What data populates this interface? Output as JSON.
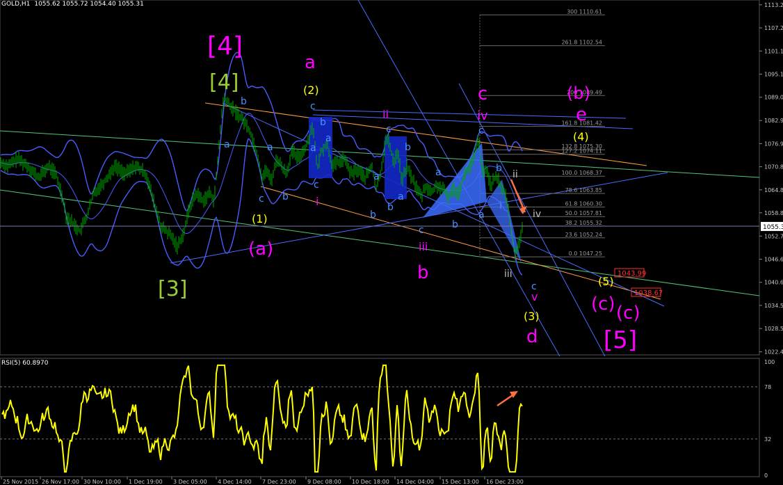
{
  "header": {
    "symbol": "GOLD,H1",
    "ohlc": "1055.62 1055.72 1054.40 1055.31"
  },
  "rsi": {
    "label": "RSI(5) 60.8970",
    "levels": [
      "100",
      "78",
      "32",
      "0"
    ]
  },
  "chart_data": [
    {
      "type": "candlestick",
      "name": "GOLD,H1",
      "y_ticks": [
        1113.25,
        1107.2,
        1101.15,
        1095.1,
        1089.05,
        1082.95,
        1076.9,
        1070.85,
        1064.8,
        1058.8,
        1052.7,
        1046.65,
        1040.6,
        1034.55,
        1028.5,
        1022.4
      ],
      "y_tick_labels": [
        "1113.25",
        "1107.20",
        "1101.15",
        "1095.10",
        "1089.05",
        "1082.95",
        "1076.90",
        "1070.85",
        "1064.80",
        "1058.80",
        "1052.70",
        "1046.65",
        "1040.60",
        "1034.55",
        "1028.50",
        "1022.40"
      ],
      "ylim": [
        1021.6,
        1114.5
      ],
      "current_price": 1055.31,
      "current_price_label": "1055.31",
      "x_tick_labels": [
        "25 Nov 2015",
        "26 Nov 17:00",
        "30 Nov 10:00",
        "1 Dec 19:00",
        "3 Dec 05:00",
        "4 Dec 14:00",
        "7 Dec 23:00",
        "9 Dec 08:00",
        "10 Dec 18:00",
        "14 Dec 04:00",
        "15 Dec 13:00",
        "16 Dec 23:00"
      ],
      "price_path": [
        [
          0,
          1072
        ],
        [
          12,
          1071
        ],
        [
          25,
          1073
        ],
        [
          40,
          1071
        ],
        [
          55,
          1068
        ],
        [
          70,
          1071
        ],
        [
          80,
          1069
        ],
        [
          90,
          1063
        ],
        [
          95,
          1058
        ],
        [
          105,
          1056
        ],
        [
          115,
          1054
        ],
        [
          125,
          1058
        ],
        [
          135,
          1064
        ],
        [
          150,
          1067
        ],
        [
          165,
          1071
        ],
        [
          180,
          1069
        ],
        [
          195,
          1071
        ],
        [
          210,
          1069
        ],
        [
          222,
          1061
        ],
        [
          232,
          1055
        ],
        [
          245,
          1053
        ],
        [
          255,
          1050
        ],
        [
          265,
          1054
        ],
        [
          272,
          1060
        ],
        [
          282,
          1064
        ],
        [
          292,
          1062
        ],
        [
          302,
          1064
        ],
        [
          308,
          1062
        ],
        [
          312,
          1070
        ],
        [
          318,
          1083
        ],
        [
          322,
          1089
        ],
        [
          330,
          1087
        ],
        [
          340,
          1085
        ],
        [
          350,
          1083
        ],
        [
          360,
          1080
        ],
        [
          370,
          1074
        ],
        [
          377,
          1068
        ],
        [
          383,
          1070
        ],
        [
          390,
          1067
        ],
        [
          398,
          1073
        ],
        [
          405,
          1071
        ],
        [
          412,
          1069
        ],
        [
          420,
          1075
        ],
        [
          428,
          1073
        ],
        [
          436,
          1075
        ],
        [
          442,
          1077
        ],
        [
          450,
          1082
        ],
        [
          456,
          1070
        ],
        [
          462,
          1075
        ],
        [
          470,
          1077
        ],
        [
          478,
          1071
        ],
        [
          486,
          1072
        ],
        [
          495,
          1073
        ],
        [
          505,
          1069
        ],
        [
          515,
          1070
        ],
        [
          525,
          1068
        ],
        [
          535,
          1071
        ],
        [
          541,
          1065
        ],
        [
          548,
          1070
        ],
        [
          555,
          1078
        ],
        [
          560,
          1077
        ],
        [
          566,
          1072
        ],
        [
          572,
          1075
        ],
        [
          578,
          1067
        ],
        [
          585,
          1071
        ],
        [
          592,
          1068
        ],
        [
          600,
          1065
        ],
        [
          606,
          1063
        ],
        [
          612,
          1066
        ],
        [
          620,
          1064
        ],
        [
          628,
          1066
        ],
        [
          636,
          1065
        ],
        [
          645,
          1063
        ],
        [
          652,
          1065
        ],
        [
          660,
          1064
        ],
        [
          666,
          1068
        ],
        [
          672,
          1070
        ],
        [
          680,
          1072
        ],
        [
          688,
          1078
        ],
        [
          694,
          1069
        ],
        [
          700,
          1070
        ],
        [
          706,
          1066
        ],
        [
          712,
          1068
        ],
        [
          718,
          1067
        ],
        [
          722,
          1065
        ],
        [
          726,
          1064
        ],
        [
          730,
          1061
        ],
        [
          734,
          1055
        ],
        [
          738,
          1050
        ],
        [
          742,
          1048
        ],
        [
          746,
          1051
        ],
        [
          752,
          1055
        ]
      ],
      "fib_levels": [
        {
          "ratio": "300",
          "price": 1110.61
        },
        {
          "ratio": "261.8",
          "price": 1102.54
        },
        {
          "ratio": "200",
          "price": 1089.49
        },
        {
          "ratio": "161.8",
          "price": 1081.42
        },
        {
          "ratio": "132.8",
          "price": 1075.3
        },
        {
          "ratio": "127.2",
          "price": 1074.11
        },
        {
          "ratio": "100.0",
          "price": 1068.37
        },
        {
          "ratio": "78.6",
          "price": 1063.85
        },
        {
          "ratio": "61.8",
          "price": 1060.3
        },
        {
          "ratio": "50.0",
          "price": 1057.81
        },
        {
          "ratio": "38.2",
          "price": 1055.32
        },
        {
          "ratio": "23.6",
          "price": 1052.24
        },
        {
          "ratio": "0.0",
          "price": 1047.25
        }
      ],
      "price_tags": [
        {
          "label": "1043.99",
          "price": 1043.99
        },
        {
          "label": "1038.67",
          "price": 1038.67
        }
      ]
    },
    {
      "type": "line",
      "name": "RSI(5)",
      "ylim": [
        0,
        100
      ],
      "levels": [
        78,
        32
      ],
      "last_value": 60.897
    }
  ],
  "wave_labels": [
    {
      "text": "[4]",
      "color": "#ff00ff"
    },
    {
      "text": "[4]",
      "color": "#9acd32"
    },
    {
      "text": "[3]",
      "color": "#9acd32"
    },
    {
      "text": "[5]",
      "color": "#ff00ff"
    },
    {
      "text": "a",
      "color": "#ff00ff"
    },
    {
      "text": "b",
      "color": "#ff00ff"
    },
    {
      "text": "c",
      "color": "#ff00ff"
    },
    {
      "text": "d",
      "color": "#ff00ff"
    },
    {
      "text": "e",
      "color": "#ff00ff"
    },
    {
      "text": "(a)",
      "color": "#ff00ff"
    },
    {
      "text": "(b)",
      "color": "#ff00ff"
    },
    {
      "text": "(c)",
      "color": "#ff00ff"
    },
    {
      "text": "(c)",
      "color": "#ff00ff"
    },
    {
      "text": "(1)",
      "color": "#ffff00"
    },
    {
      "text": "(2)",
      "color": "#ffff00"
    },
    {
      "text": "(3)",
      "color": "#ffff00"
    },
    {
      "text": "(4)",
      "color": "#ffff00"
    },
    {
      "text": "(5)",
      "color": "#ffff00"
    },
    {
      "text": "i",
      "color": "#ff00ff"
    },
    {
      "text": "ii",
      "color": "#ff00ff"
    },
    {
      "text": "iii",
      "color": "#ff00ff"
    },
    {
      "text": "iv",
      "color": "#ff00ff"
    },
    {
      "text": "v",
      "color": "#ff00ff"
    },
    {
      "text": "ii",
      "color": "#c0c0c0"
    },
    {
      "text": "iii",
      "color": "#c0c0c0"
    },
    {
      "text": "iv",
      "color": "#c0c0c0"
    },
    {
      "text": "a",
      "color": "#4a90ff"
    },
    {
      "text": "b",
      "color": "#4a90ff"
    },
    {
      "text": "c",
      "color": "#4a90ff"
    },
    {
      "text": "i",
      "color": "#4a90ff"
    }
  ],
  "colors": {
    "background": "#000000",
    "candles": "#00b000",
    "bands": "#4060ff",
    "rsi": "#ffff00",
    "fib": "#808080",
    "arrow": "#ff8040"
  }
}
